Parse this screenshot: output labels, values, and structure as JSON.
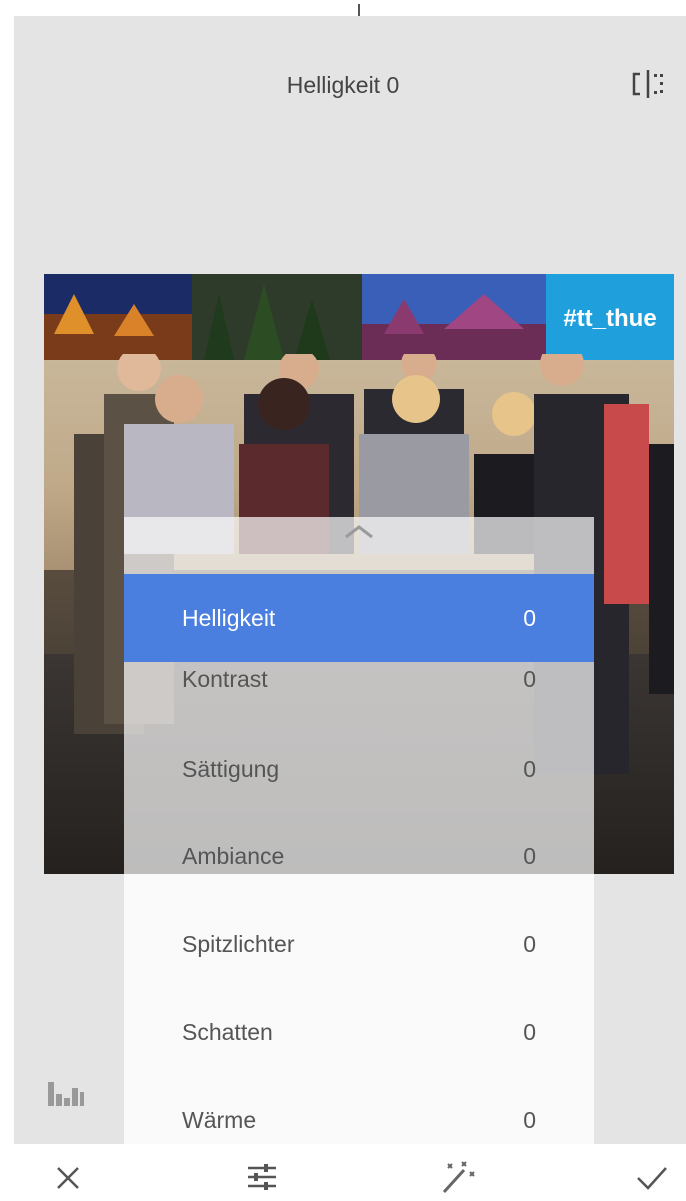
{
  "header": {
    "title": "Helligkeit 0",
    "compare_icon": "compare-icon"
  },
  "photo": {
    "banner_tag": "#tt_thue"
  },
  "adjust_menu": {
    "items": [
      {
        "label": "Helligkeit",
        "value": "0",
        "selected": true
      },
      {
        "label": "Kontrast",
        "value": "0",
        "selected": false
      },
      {
        "label": "Sättigung",
        "value": "0",
        "selected": false
      },
      {
        "label": "Ambiance",
        "value": "0",
        "selected": false
      },
      {
        "label": "Spitzlichter",
        "value": "0",
        "selected": false
      },
      {
        "label": "Schatten",
        "value": "0",
        "selected": false
      },
      {
        "label": "Wärme",
        "value": "0",
        "selected": false
      }
    ]
  },
  "toolbar": {
    "cancel_icon": "close-icon",
    "adjust_icon": "sliders-icon",
    "auto_icon": "magic-wand-icon",
    "apply_icon": "checkmark-icon",
    "histogram_icon": "histogram-icon"
  },
  "colors": {
    "accent": "#4a7fe0",
    "background": "#e4e4e4"
  }
}
